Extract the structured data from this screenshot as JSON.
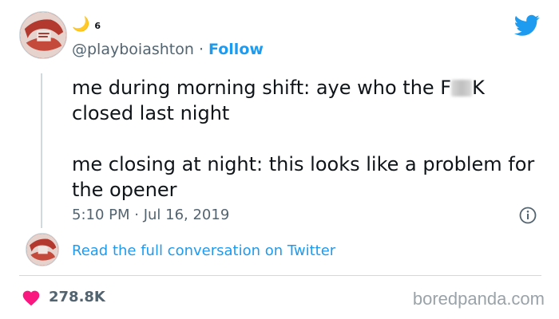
{
  "author": {
    "display_name_emoji": "🌙",
    "display_name_number": "6",
    "handle": "@playboiashton",
    "separator": "·",
    "follow_label": "Follow"
  },
  "tweet": {
    "line1_before": "me during morning shift: aye who the F",
    "line1_after": "K",
    "line1_end": "closed last night",
    "line2": "me closing at night: this looks like a problem for the opener",
    "timestamp": "5:10 PM · Jul 16, 2019"
  },
  "conversation": {
    "link_label": "Read the full conversation on Twitter"
  },
  "stats": {
    "likes": "278.8K"
  },
  "brand": {
    "watermark": "boredpanda.com"
  },
  "colors": {
    "accent": "#1d9bf0",
    "like": "#f91880",
    "muted": "#536471"
  },
  "icons": [
    "twitter-bird-icon",
    "moon-icon",
    "info-icon",
    "heart-icon"
  ]
}
